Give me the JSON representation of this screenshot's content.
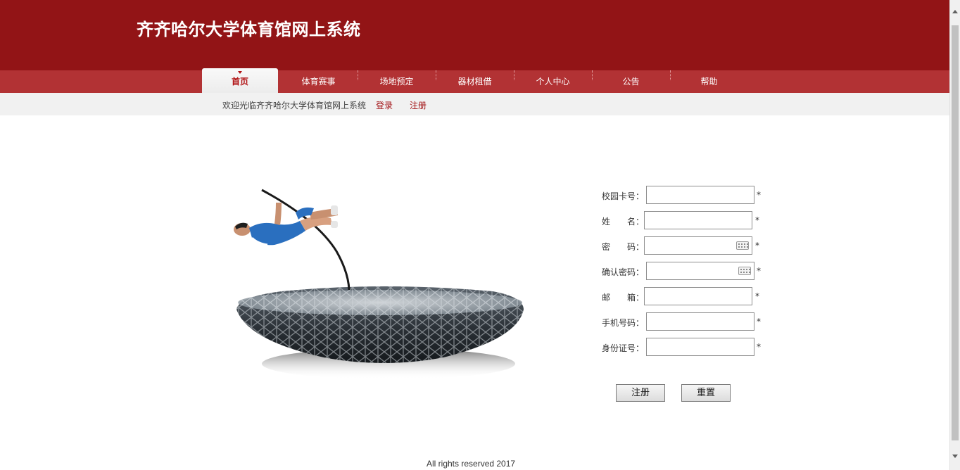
{
  "header": {
    "title": "齐齐哈尔大学体育馆网上系统",
    "bg_color": "#921416"
  },
  "nav": {
    "items": [
      {
        "label": "首页",
        "active": true
      },
      {
        "label": "体育赛事"
      },
      {
        "label": "场地预定"
      },
      {
        "label": "器材租借"
      },
      {
        "label": "个人中心"
      },
      {
        "label": "公告"
      },
      {
        "label": "帮助"
      }
    ],
    "bg_color": "#b23234"
  },
  "subbar": {
    "welcome": "欢迎光临齐齐哈尔大学体育馆网上系统",
    "login": "登录",
    "register": "注册"
  },
  "form": {
    "fields": [
      {
        "label": "校园卡号：",
        "value": "",
        "required": "*"
      },
      {
        "label": "姓　　名：",
        "value": "",
        "required": "*"
      },
      {
        "label": "密　　码：",
        "value": "",
        "required": "*",
        "icon": "keyboard-icon"
      },
      {
        "label": "确认密码：",
        "value": "",
        "required": "*",
        "icon": "keyboard-icon"
      },
      {
        "label": "邮　　箱：",
        "value": "",
        "required": "*"
      },
      {
        "label": "手机号码：",
        "value": "",
        "required": "*"
      },
      {
        "label": "身份证号：",
        "value": "",
        "required": "*"
      }
    ],
    "submit_label": "注册",
    "reset_label": "重置"
  },
  "hero": {
    "icon": "pole-vault-stadium-image"
  },
  "footer": {
    "text": "All rights reserved 2017"
  }
}
